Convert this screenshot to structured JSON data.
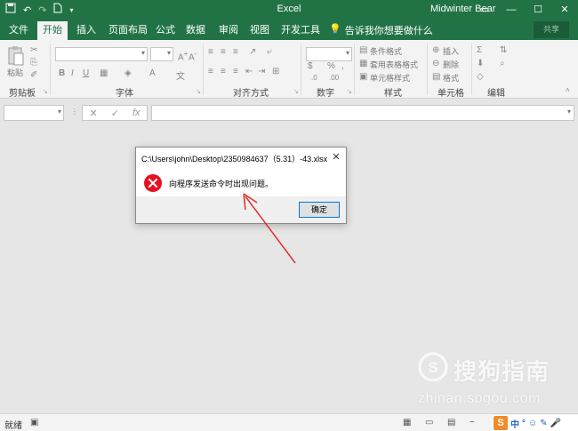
{
  "titlebar": {
    "app_title": "Excel",
    "user_name": "Midwinter Bear",
    "qat_icons": [
      "save-icon",
      "undo-icon",
      "redo-icon",
      "new-file-icon",
      "customize-qat-icon"
    ],
    "window_buttons": [
      "ribbon-display-icon",
      "minimize-icon",
      "restore-icon",
      "close-icon"
    ]
  },
  "tabs": {
    "file": "文件",
    "home": "开始",
    "insert": "插入",
    "page_layout": "页面布局",
    "formulas": "公式",
    "data": "数据",
    "review": "审阅",
    "view": "视图",
    "developer": "开发工具",
    "tell_me": "告诉我你想要做什么",
    "share": "共享"
  },
  "ribbon": {
    "groups": {
      "clipboard": "剪贴板",
      "font": "字体",
      "alignment": "对齐方式",
      "number": "数字",
      "styles": "样式",
      "cells": "单元格",
      "editing": "编辑"
    },
    "paste_label": "粘贴",
    "styles_items": [
      "条件格式",
      "套用表格格式",
      "单元格样式"
    ],
    "cells_items": [
      "插入",
      "删除",
      "格式"
    ],
    "font_buttons": [
      "B",
      "I",
      "U"
    ],
    "number_symbols": [
      "%",
      ","
    ]
  },
  "formula_bar": {
    "cancel": "✕",
    "enter": "✓",
    "fx": "fx"
  },
  "dialog": {
    "title": "C:\\Users\\john\\Desktop\\2350984637（5.31）-43.xlsx",
    "message": "向程序发送命令时出现问题。",
    "ok_label": "确定",
    "close_glyph": "✕"
  },
  "statusbar": {
    "ready": "就绪"
  },
  "ime": {
    "logo": "S",
    "items": [
      "中",
      "°",
      "☺",
      "✎",
      "🎤"
    ]
  },
  "watermark": {
    "brand": "搜狗指南",
    "url": "zhinan.sogou.com"
  },
  "colors": {
    "excel_green": "#217346",
    "error_red": "#e81123",
    "annotation_red": "#e03030"
  }
}
